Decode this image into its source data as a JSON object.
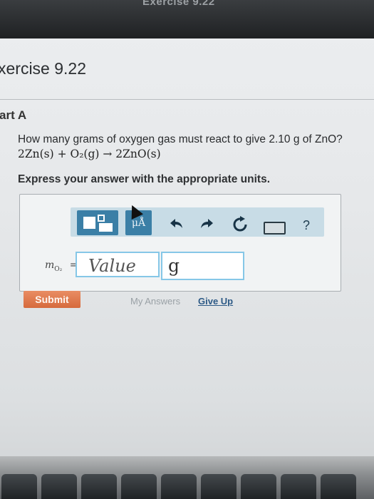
{
  "window": {
    "top_bar_title": "Exercise 9.22"
  },
  "exercise": {
    "title": "xercise 9.22",
    "part_label": "art A"
  },
  "question": {
    "prompt": "How many grams of oxygen gas must react to give 2.10 g of ZnO?",
    "equation": "2Zn(s) + O₂(g) → 2ZnO(s)",
    "instruction": "Express your answer with the appropriate units."
  },
  "toolbar": {
    "mu_label": "μÅ",
    "undo_icon": "undo-arrow-icon",
    "redo_icon": "redo-arrow-icon",
    "reset_icon": "reset-icon",
    "keyboard_icon": "keyboard-icon",
    "help_label": "?"
  },
  "answer": {
    "variable_label": "m",
    "variable_sub": "O₂",
    "equals": "=",
    "value_placeholder": "Value",
    "unit_value": "g"
  },
  "actions": {
    "submit_label": "Submit",
    "my_answers_label": "My Answers",
    "give_up_label": "Give Up"
  },
  "colors": {
    "accent_blue": "#3b7fa6",
    "submit_orange": "#d66a3d",
    "input_border": "#86c7e7"
  }
}
